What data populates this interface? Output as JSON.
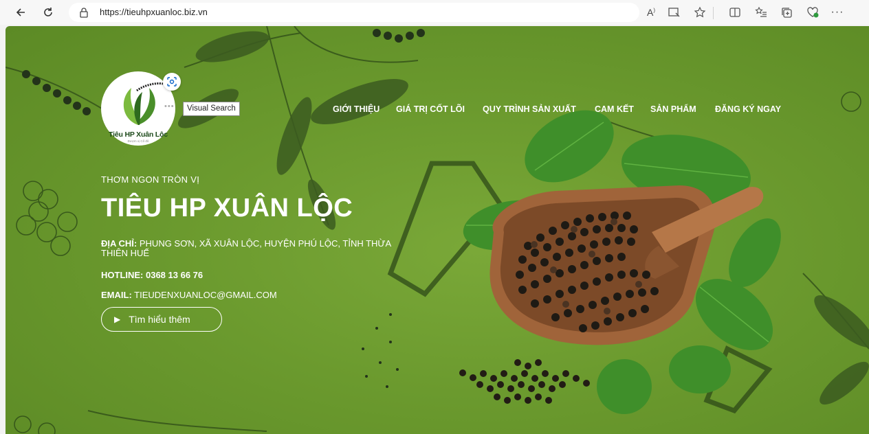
{
  "browser": {
    "url": "https://tieuhpxuanloc.biz.vn",
    "icons": [
      "back-icon",
      "refresh-icon",
      "lock-icon",
      "read-aloud-icon",
      "immersive-reader-icon",
      "favorite-icon",
      "split-screen-icon",
      "favorites-list-icon",
      "collections-icon",
      "browser-essentials-icon",
      "more-icon"
    ]
  },
  "logo": {
    "name": "Tiêu HP Xuân Lộc",
    "sub": "Đượm vị Cố đô"
  },
  "visual_search": {
    "tooltip": "Visual Search",
    "dots": "•••"
  },
  "menu": [
    {
      "label": "GIỚI THIỆU"
    },
    {
      "label": "GIÁ TRỊ CỐT LÕI"
    },
    {
      "label": "QUY TRÌNH SẢN XUẤT"
    },
    {
      "label": "CAM KẾT"
    },
    {
      "label": "SẢN PHẨM"
    },
    {
      "label": "ĐĂNG KÝ NGAY"
    }
  ],
  "hero": {
    "tagline": "THƠM NGON TRÒN VỊ",
    "title": "TIÊU HP XUÂN LỘC",
    "address_label": "ĐỊA CHỈ:",
    "address": "PHUNG SƠN, XÃ XUÂN LỘC, HUYỆN PHÚ LỘC, TỈNH THỪA THIÊN HUẾ",
    "hotline": "HOTLINE: 0368 13 66 76",
    "email_label": "EMAIL:",
    "email": "TIEUDENXUANLOC@GMAIL.COM",
    "cta": "Tìm hiểu thêm"
  },
  "colors": {
    "hero_bg": "#6b9a2e",
    "text": "#ffffff",
    "leaf": "#3f8f2a",
    "bowl": "#a0643a"
  }
}
